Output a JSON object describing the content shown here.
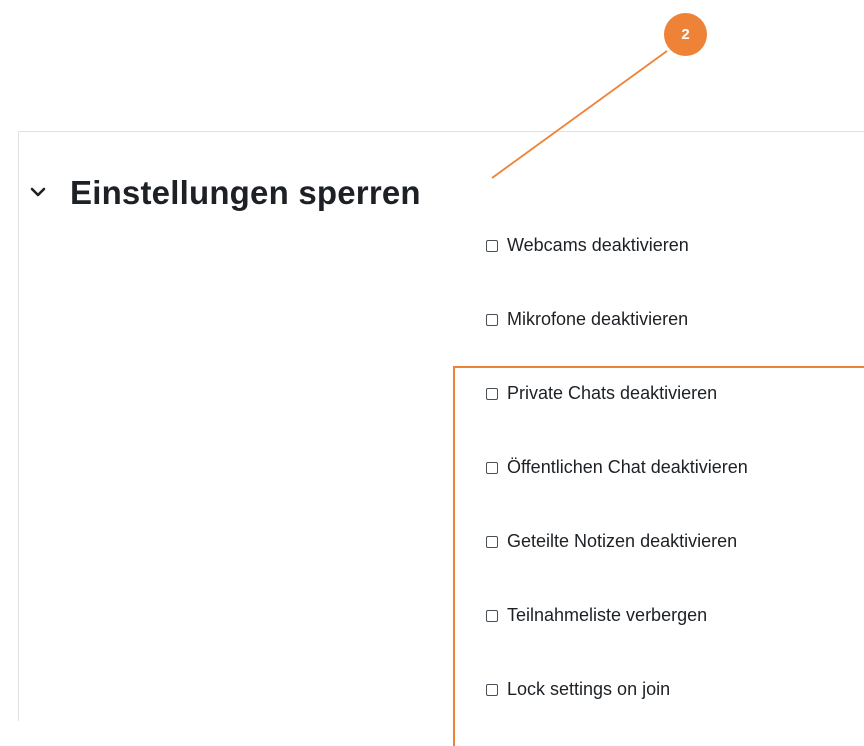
{
  "annotation": {
    "badge_number": "2",
    "color": "#ee8236"
  },
  "section": {
    "title": "Einstellungen sperren",
    "chevron_icon": "chevron-down-icon",
    "expanded": true
  },
  "lock_settings": {
    "items": [
      {
        "label": "Webcams deaktivieren",
        "checked": false
      },
      {
        "label": "Mikrofone deaktivieren",
        "checked": false
      },
      {
        "label": "Private Chats deaktivieren",
        "checked": false
      },
      {
        "label": "Öffentlichen Chat deaktivieren",
        "checked": false
      },
      {
        "label": "Geteilte Notizen deaktivieren",
        "checked": false
      },
      {
        "label": "Teilnahmeliste verbergen",
        "checked": false
      },
      {
        "label": "Lock settings on join",
        "checked": false
      }
    ]
  },
  "colors": {
    "text": "#1d2125",
    "border": "#dee2e6",
    "accent": "#ee8236"
  }
}
